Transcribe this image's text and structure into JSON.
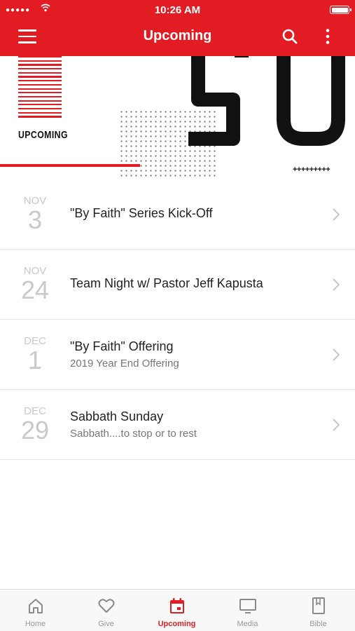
{
  "status_bar": {
    "signal": "●●●●●",
    "time": "10:26 AM"
  },
  "header": {
    "title": "Upcoming"
  },
  "banner": {
    "label": "UPCOMING",
    "big_text": "SU",
    "plus_text": "+++++++++"
  },
  "colors": {
    "accent": "#e31b23",
    "muted_date": "#c9c9c9",
    "subtitle": "#777777"
  },
  "events": [
    {
      "month": "NOV",
      "day": "3",
      "title": "\"By Faith\" Series Kick-Off",
      "subtitle": ""
    },
    {
      "month": "NOV",
      "day": "24",
      "title": "Team Night w/ Pastor Jeff Kapusta",
      "subtitle": ""
    },
    {
      "month": "DEC",
      "day": "1",
      "title": "\"By Faith\" Offering",
      "subtitle": "2019 Year End Offering"
    },
    {
      "month": "DEC",
      "day": "29",
      "title": "Sabbath Sunday",
      "subtitle": "Sabbath....to stop or to rest"
    }
  ],
  "tabs": [
    {
      "label": "Home",
      "icon": "home-icon"
    },
    {
      "label": "Give",
      "icon": "heart-icon"
    },
    {
      "label": "Upcoming",
      "icon": "calendar-icon",
      "active": true
    },
    {
      "label": "Media",
      "icon": "monitor-icon"
    },
    {
      "label": "Bible",
      "icon": "book-icon"
    }
  ]
}
